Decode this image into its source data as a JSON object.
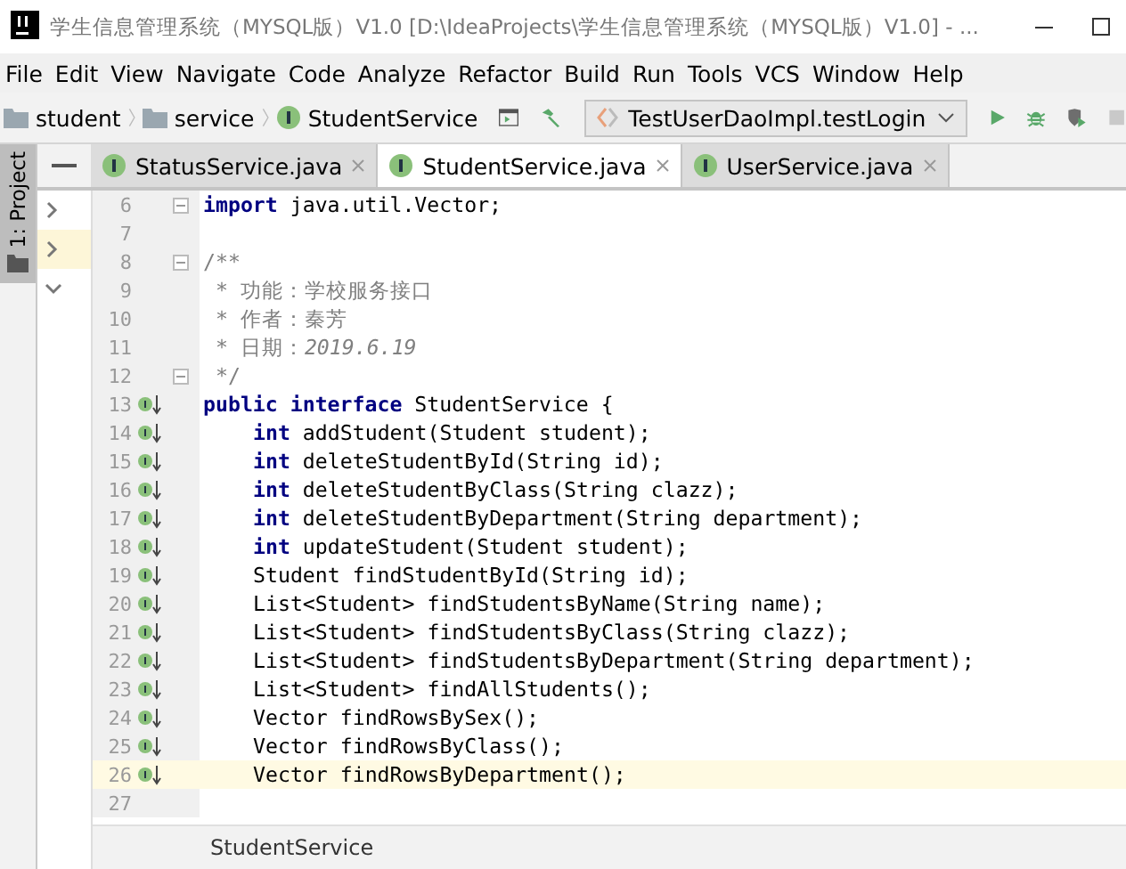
{
  "window": {
    "title": "学生信息管理系统（MYSQL版）V1.0 [D:\\IdeaProjects\\学生信息管理系统（MYSQL版）V1.0] - ..."
  },
  "menu": [
    "File",
    "Edit",
    "View",
    "Navigate",
    "Code",
    "Analyze",
    "Refactor",
    "Build",
    "Run",
    "Tools",
    "VCS",
    "Window",
    "Help"
  ],
  "breadcrumb": [
    {
      "label": "student",
      "kind": "folder"
    },
    {
      "label": "service",
      "kind": "folder"
    },
    {
      "label": "StudentService",
      "kind": "interface"
    }
  ],
  "run_config": "TestUserDaoImpl.testLogin",
  "tool_window": {
    "label": "1: Project"
  },
  "project_tree": [
    {
      "expanded": false,
      "selected": false
    },
    {
      "expanded": false,
      "selected": true
    },
    {
      "expanded": true,
      "selected": false
    }
  ],
  "tabs": [
    {
      "label": "StatusService.java",
      "selected": false
    },
    {
      "label": "StudentService.java",
      "selected": true
    },
    {
      "label": "UserService.java",
      "selected": false
    }
  ],
  "code": [
    {
      "number": "6",
      "fold": true,
      "implemented": false,
      "current": false,
      "tokens": [
        {
          "kind": "kw",
          "text": "import"
        },
        {
          "kind": "plain",
          "text": " java.util.Vector;"
        }
      ]
    },
    {
      "number": "7",
      "fold": false,
      "implemented": false,
      "current": false
    },
    {
      "number": "8",
      "fold": true,
      "implemented": false,
      "current": false,
      "tokens": [
        {
          "kind": "doc",
          "text": "/**"
        }
      ]
    },
    {
      "number": "9",
      "fold": false,
      "implemented": false,
      "current": false,
      "tokens": [
        {
          "kind": "doc",
          "text": " * 功能：学校服务接口"
        }
      ]
    },
    {
      "number": "10",
      "fold": false,
      "implemented": false,
      "current": false,
      "tokens": [
        {
          "kind": "doc",
          "text": " * 作者：秦芳"
        }
      ]
    },
    {
      "number": "11",
      "fold": false,
      "implemented": false,
      "current": false,
      "tokens": [
        {
          "kind": "doc",
          "text": " * 日期："
        },
        {
          "kind": "doc-value",
          "text": "2019.6.19"
        }
      ]
    },
    {
      "number": "12",
      "fold": true,
      "implemented": false,
      "current": false,
      "tokens": [
        {
          "kind": "doc",
          "text": " */"
        }
      ]
    },
    {
      "number": "13",
      "fold": false,
      "implemented": true,
      "current": false,
      "tokens": [
        {
          "kind": "kw",
          "text": "public interface"
        },
        {
          "kind": "plain",
          "text": " StudentService {"
        }
      ]
    },
    {
      "number": "14",
      "fold": false,
      "implemented": true,
      "current": false,
      "indented": true,
      "tokens": [
        {
          "kind": "kw",
          "text": "int"
        },
        {
          "kind": "plain",
          "text": " addStudent(Student student);"
        }
      ]
    },
    {
      "number": "15",
      "fold": false,
      "implemented": true,
      "current": false,
      "indented": true,
      "tokens": [
        {
          "kind": "kw",
          "text": "int"
        },
        {
          "kind": "plain",
          "text": " deleteStudentById(String id);"
        }
      ]
    },
    {
      "number": "16",
      "fold": false,
      "implemented": true,
      "current": false,
      "indented": true,
      "tokens": [
        {
          "kind": "kw",
          "text": "int"
        },
        {
          "kind": "plain",
          "text": " deleteStudentByClass(String clazz);"
        }
      ]
    },
    {
      "number": "17",
      "fold": false,
      "implemented": true,
      "current": false,
      "indented": true,
      "tokens": [
        {
          "kind": "kw",
          "text": "int"
        },
        {
          "kind": "plain",
          "text": " deleteStudentByDepartment(String department);"
        }
      ]
    },
    {
      "number": "18",
      "fold": false,
      "implemented": true,
      "current": false,
      "indented": true,
      "tokens": [
        {
          "kind": "kw",
          "text": "int"
        },
        {
          "kind": "plain",
          "text": " updateStudent(Student student);"
        }
      ]
    },
    {
      "number": "19",
      "fold": false,
      "implemented": true,
      "current": false,
      "indented": true,
      "tokens": [
        {
          "kind": "plain",
          "text": "Student findStudentById(String id);"
        }
      ]
    },
    {
      "number": "20",
      "fold": false,
      "implemented": true,
      "current": false,
      "indented": true,
      "tokens": [
        {
          "kind": "plain",
          "text": "List<Student> findStudentsByName(String name);"
        }
      ]
    },
    {
      "number": "21",
      "fold": false,
      "implemented": true,
      "current": false,
      "indented": true,
      "tokens": [
        {
          "kind": "plain",
          "text": "List<Student> findStudentsByClass(String clazz);"
        }
      ]
    },
    {
      "number": "22",
      "fold": false,
      "implemented": true,
      "current": false,
      "indented": true,
      "tokens": [
        {
          "kind": "plain",
          "text": "List<Student> findStudentsByDepartment(String department);"
        }
      ]
    },
    {
      "number": "23",
      "fold": false,
      "implemented": true,
      "current": false,
      "indented": true,
      "tokens": [
        {
          "kind": "plain",
          "text": "List<Student> findAllStudents();"
        }
      ]
    },
    {
      "number": "24",
      "fold": false,
      "implemented": true,
      "current": false,
      "indented": true,
      "tokens": [
        {
          "kind": "plain",
          "text": "Vector findRowsBySex();"
        }
      ]
    },
    {
      "number": "25",
      "fold": false,
      "implemented": true,
      "current": false,
      "indented": true,
      "tokens": [
        {
          "kind": "plain",
          "text": "Vector findRowsByClass();"
        }
      ]
    },
    {
      "number": "26",
      "fold": false,
      "implemented": true,
      "current": true,
      "indented": true,
      "tokens": [
        {
          "kind": "plain",
          "text": "Vector findRowsByDepartment();"
        }
      ]
    },
    {
      "number": "27",
      "fold": false,
      "implemented": false,
      "current": false
    }
  ],
  "editor_breadcrumb": "StudentService"
}
